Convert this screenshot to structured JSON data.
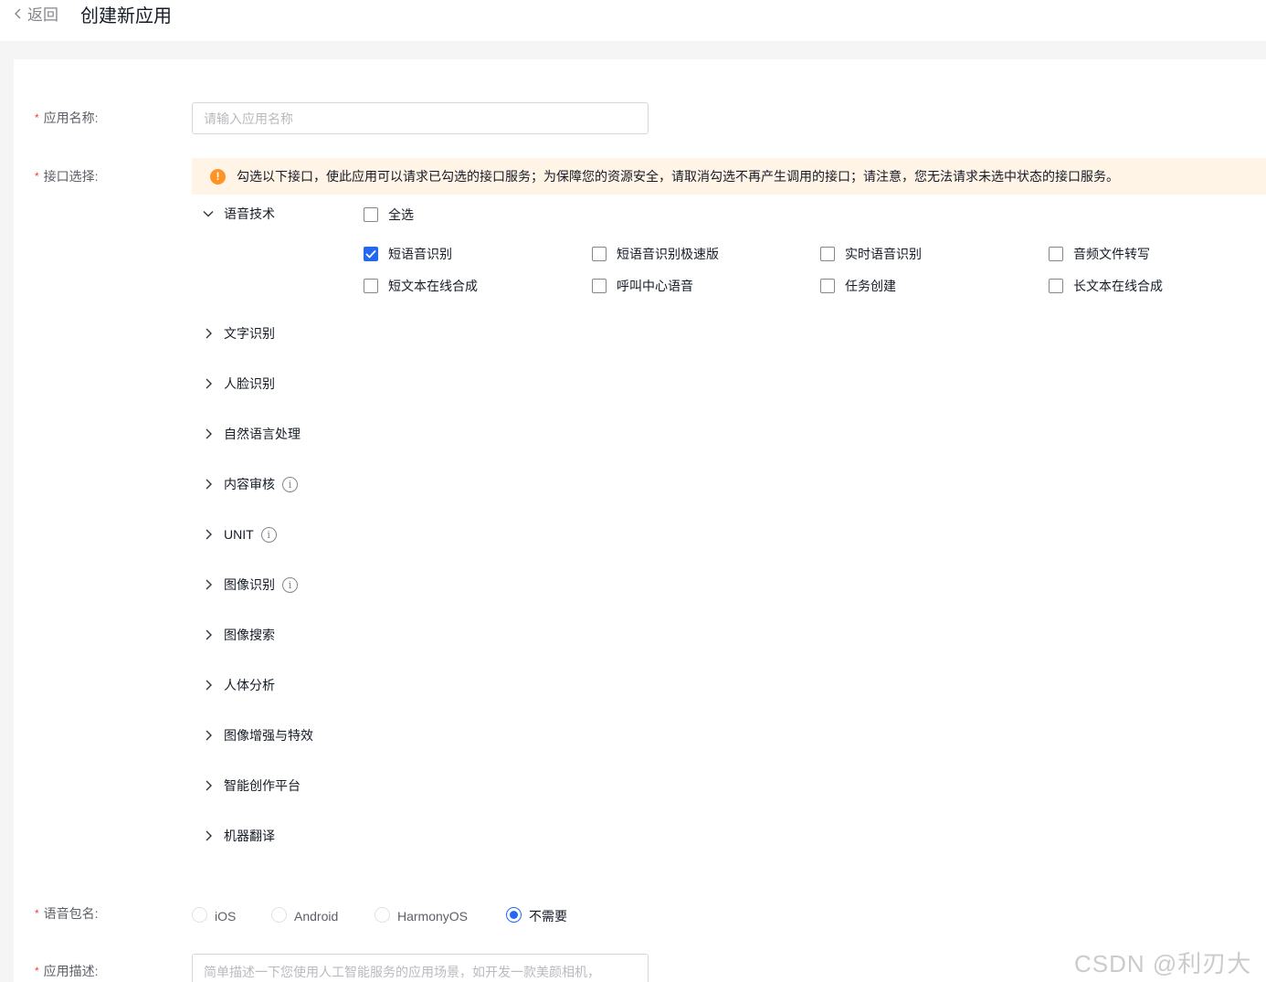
{
  "header": {
    "back_label": "返回",
    "title": "创建新应用"
  },
  "form": {
    "name_label": "应用名称:",
    "name_placeholder": "请输入应用名称",
    "api_label": "接口选择:",
    "notice": "勾选以下接口，使此应用可以请求已勾选的接口服务；为保障您的资源安全，请取消勾选不再产生调用的接口；请注意，您无法请求未选中状态的接口服务。",
    "speech": {
      "label": "语音技术",
      "select_all": "全选",
      "options": [
        {
          "label": "短语音识别",
          "checked": true
        },
        {
          "label": "短语音识别极速版",
          "checked": false
        },
        {
          "label": "实时语音识别",
          "checked": false
        },
        {
          "label": "音频文件转写",
          "checked": false
        },
        {
          "label": "短文本在线合成",
          "checked": false
        },
        {
          "label": "呼叫中心语音",
          "checked": false
        },
        {
          "label": "任务创建",
          "checked": false
        },
        {
          "label": "长文本在线合成",
          "checked": false
        }
      ]
    },
    "categories": [
      {
        "label": "文字识别",
        "info": false
      },
      {
        "label": "人脸识别",
        "info": false
      },
      {
        "label": "自然语言处理",
        "info": false
      },
      {
        "label": "内容审核",
        "info": true
      },
      {
        "label": "UNIT",
        "info": true
      },
      {
        "label": "图像识别",
        "info": true
      },
      {
        "label": "图像搜索",
        "info": false
      },
      {
        "label": "人体分析",
        "info": false
      },
      {
        "label": "图像增强与特效",
        "info": false
      },
      {
        "label": "智能创作平台",
        "info": false
      },
      {
        "label": "机器翻译",
        "info": false
      }
    ],
    "package_label": "语音包名:",
    "package_options": [
      {
        "label": "iOS",
        "selected": false
      },
      {
        "label": "Android",
        "selected": false
      },
      {
        "label": "HarmonyOS",
        "selected": false
      },
      {
        "label": "不需要",
        "selected": true
      }
    ],
    "desc_label": "应用描述:",
    "desc_placeholder": "简单描述一下您使用人工智能服务的应用场景，如开发一款美颜相机，"
  },
  "watermark": "CSDN @利刃大大",
  "colors": {
    "primary": "#2468f2",
    "warning": "#ff9326",
    "required": "#f33e3e"
  }
}
